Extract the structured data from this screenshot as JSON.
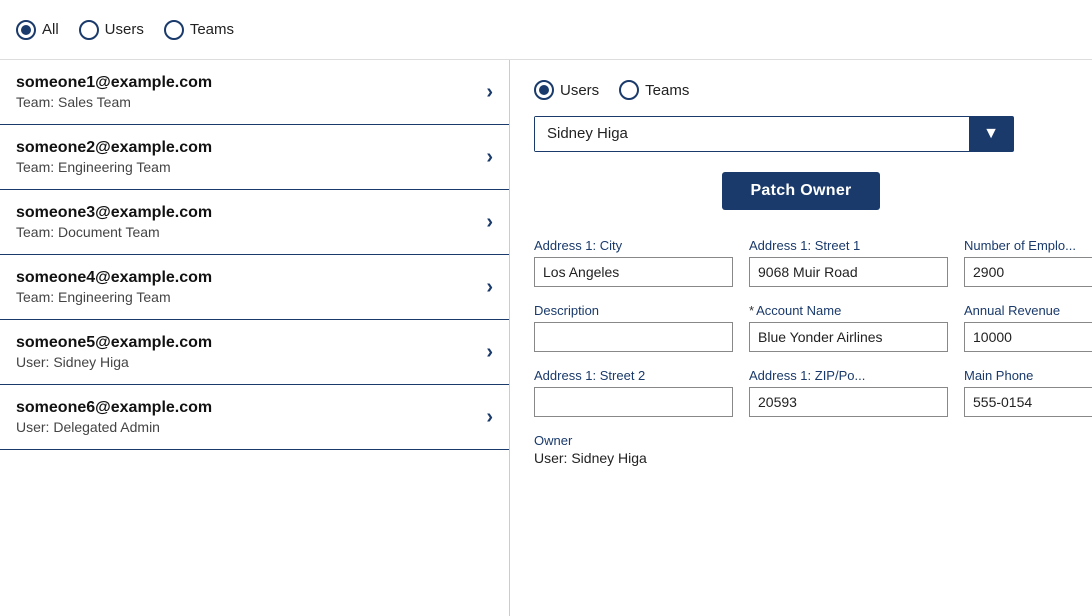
{
  "topRadio": {
    "options": [
      "All",
      "Users",
      "Teams"
    ],
    "selected": "All"
  },
  "listItems": [
    {
      "email": "someone1@example.com",
      "team": "Team: Sales Team"
    },
    {
      "email": "someone2@example.com",
      "team": "Team: Engineering Team"
    },
    {
      "email": "someone3@example.com",
      "team": "Team: Document Team"
    },
    {
      "email": "someone4@example.com",
      "team": "Team: Engineering Team"
    },
    {
      "email": "someone5@example.com",
      "team": "User: Sidney Higa"
    },
    {
      "email": "someone6@example.com",
      "team": "User: Delegated Admin"
    }
  ],
  "rightPanel": {
    "radioOptions": [
      "Users",
      "Teams"
    ],
    "radioSelected": "Users",
    "dropdownValue": "Sidney Higa",
    "dropdownChevron": "▼",
    "patchOwnerLabel": "Patch Owner",
    "fields": [
      {
        "label": "Address 1: City",
        "value": "Los Angeles",
        "required": false
      },
      {
        "label": "Address 1: Street 1",
        "value": "9068 Muir Road",
        "required": false
      },
      {
        "label": "Number of Emplo...",
        "value": "2900",
        "required": false
      },
      {
        "label": "Description",
        "value": "",
        "required": false
      },
      {
        "label": "Account Name",
        "value": "Blue Yonder Airlines",
        "required": true
      },
      {
        "label": "Annual Revenue",
        "value": "10000",
        "required": false
      },
      {
        "label": "Address 1: Street 2",
        "value": "",
        "required": false
      },
      {
        "label": "Address 1: ZIP/Po...",
        "value": "20593",
        "required": false
      },
      {
        "label": "Main Phone",
        "value": "555-0154",
        "required": false
      }
    ],
    "owner": {
      "label": "Owner",
      "value": "User: Sidney Higa"
    }
  }
}
